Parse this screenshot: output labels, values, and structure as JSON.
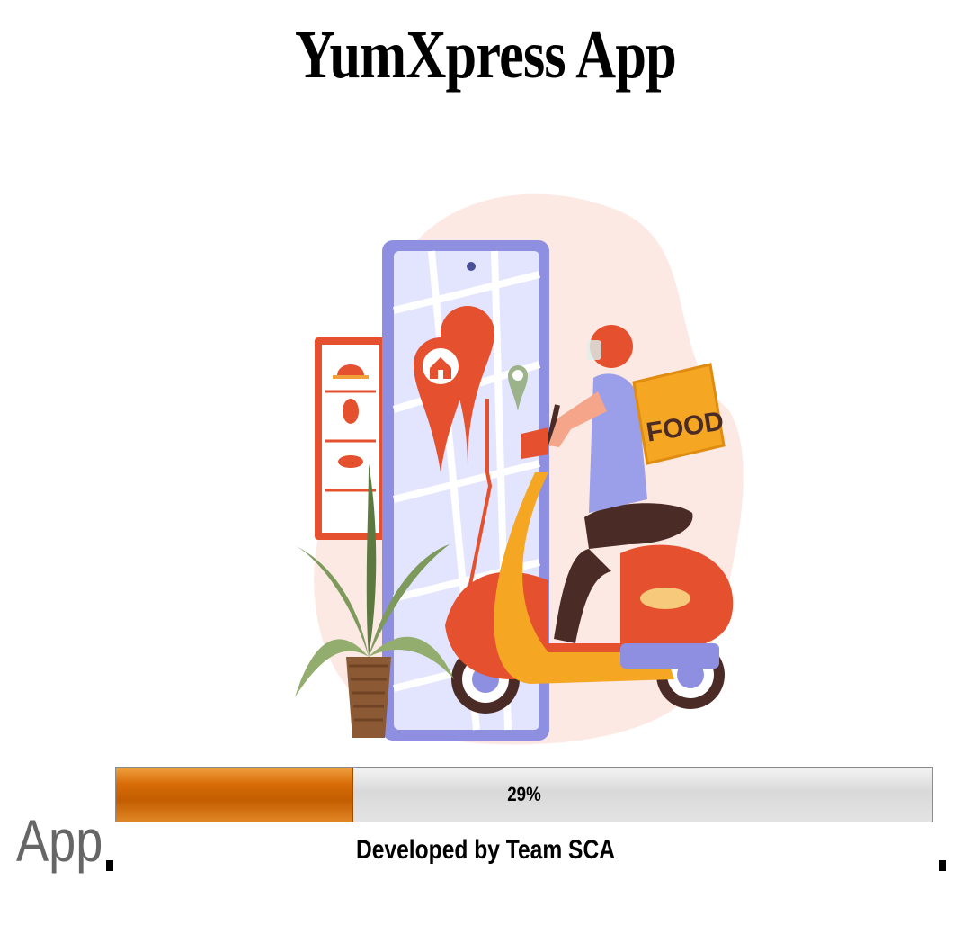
{
  "app": {
    "title": "YumXpress App"
  },
  "splash": {
    "illustration_icon": "food-delivery-illustration",
    "progress": {
      "percent": 29,
      "label": "29%"
    },
    "credit": "Developed by Team SCA",
    "stray_label": "App"
  },
  "colors": {
    "progress_fill": "#d86d08",
    "progress_track": "#e0e0e0",
    "accent_orange": "#f08c1e",
    "accent_red": "#e5502e",
    "phone_purple": "#8e8fe0"
  }
}
